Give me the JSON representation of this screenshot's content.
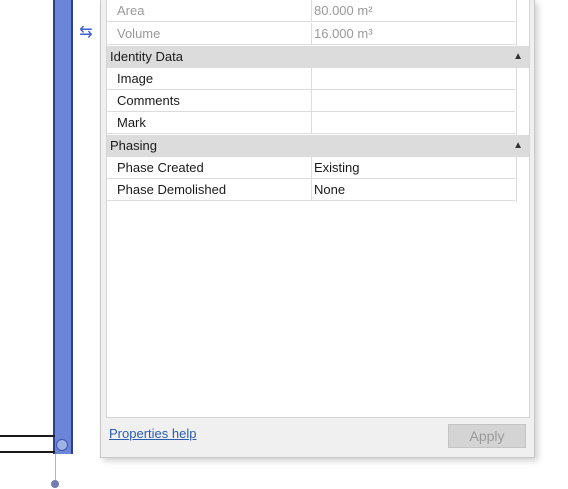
{
  "canvas": {
    "resize_icon": "double-arrow-icon",
    "wall_color": "#6b86d6"
  },
  "properties": {
    "rows_top": [
      {
        "name": "Area",
        "value": "80.000 m²",
        "disabled": true
      },
      {
        "name": "Volume",
        "value": "16.000 m³",
        "disabled": true
      }
    ],
    "groups": [
      {
        "title": "Identity Data",
        "collapse_icon": "collapse-up-icon",
        "rows": [
          {
            "name": "Image",
            "value": ""
          },
          {
            "name": "Comments",
            "value": ""
          },
          {
            "name": "Mark",
            "value": ""
          }
        ]
      },
      {
        "title": "Phasing",
        "collapse_icon": "collapse-up-icon",
        "rows": [
          {
            "name": "Phase Created",
            "value": "Existing"
          },
          {
            "name": "Phase Demolished",
            "value": "None"
          }
        ]
      }
    ],
    "help_link": "Properties help",
    "apply_label": "Apply"
  }
}
